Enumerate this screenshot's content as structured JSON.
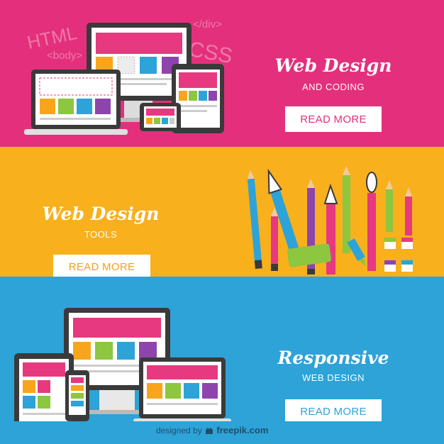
{
  "banner_web_design_coding": {
    "code_words": [
      "HTML",
      "</div>",
      "<body>",
      "CSS"
    ],
    "title": "Web Design",
    "subtitle": "AND CODING",
    "button_label": "READ MORE",
    "background": "#e4307c"
  },
  "banner_web_design_tools": {
    "title": "Web Design",
    "subtitle": "TOOLS",
    "button_label": "READ MORE",
    "background": "#f8b01d"
  },
  "banner_responsive": {
    "title": "Responsive",
    "subtitle": "WEB DESIGN",
    "button_label": "READ MORE",
    "background": "#2da3d8"
  },
  "footer": {
    "designed_by": "designed by",
    "brand": "freepik.com",
    "icon": "freepik-logo-icon"
  },
  "palette": {
    "pink": "#e6397f",
    "orange": "#f8a51b",
    "green": "#8dc63f",
    "blue": "#2da3d8",
    "purple": "#8e44ad",
    "dark": "#3a3a3a"
  }
}
